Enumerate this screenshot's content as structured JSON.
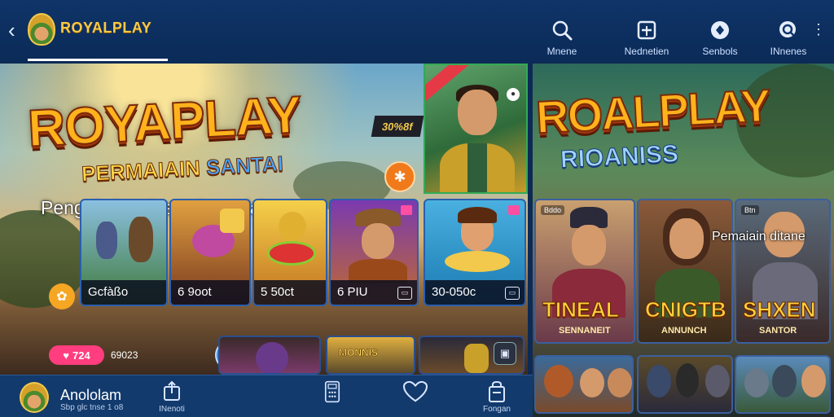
{
  "app": {
    "brand": "ROYALPLAY"
  },
  "topnav": [
    {
      "label": "Mnene",
      "icon": "search-icon"
    },
    {
      "label": "Nednetien",
      "icon": "ticket-icon"
    },
    {
      "label": "Senbols",
      "icon": "settings-circle-icon"
    },
    {
      "label": "INnenes",
      "icon": "chat-search-icon"
    }
  ],
  "hero": {
    "title": "ROYAPLAY",
    "subtitle_main": "PERMAIAIN",
    "subtitle_accent": "SANTAI",
    "tag": "30%8f",
    "headline": "Pengalmina Steru Seru dalam"
  },
  "games": [
    {
      "caption": "Gcfàßo"
    },
    {
      "caption": "6 9oot"
    },
    {
      "caption": "5 50ct"
    },
    {
      "caption": "6 PIU"
    },
    {
      "caption": "30-050c"
    }
  ],
  "promo": {
    "pill": "724",
    "count": "69023"
  },
  "mini_cards": [
    {
      "label": ""
    },
    {
      "label": "MONNIS"
    },
    {
      "label": ""
    }
  ],
  "right": {
    "title": "ROALPLAY",
    "subtitle": "RIOANISS",
    "overlay_text": "Pemaiain ditane",
    "cards": [
      {
        "big": "TINEAL",
        "small": "SENNANEIT",
        "tag": "Bddo"
      },
      {
        "big": "CNIGTB",
        "small": "ANNUNCH",
        "tag": ""
      },
      {
        "big": "SHXEN",
        "small": "SANTOR",
        "tag": "Btn"
      }
    ]
  },
  "bottombar": {
    "name": "Anololam",
    "sub": "Sbp glc tnse 1 o8",
    "items": [
      {
        "label": "INenoti",
        "icon": "upload-icon"
      },
      {
        "label": "",
        "icon": "calculator-icon"
      },
      {
        "label": "",
        "icon": "heart-icon"
      },
      {
        "label": "Fongan",
        "icon": "wallet-icon"
      }
    ]
  },
  "colors": {
    "topbar": "#0f3468",
    "brand": "#f7c948",
    "accent_pink": "#ff3d7f",
    "accent_blue": "#2e8bff"
  }
}
